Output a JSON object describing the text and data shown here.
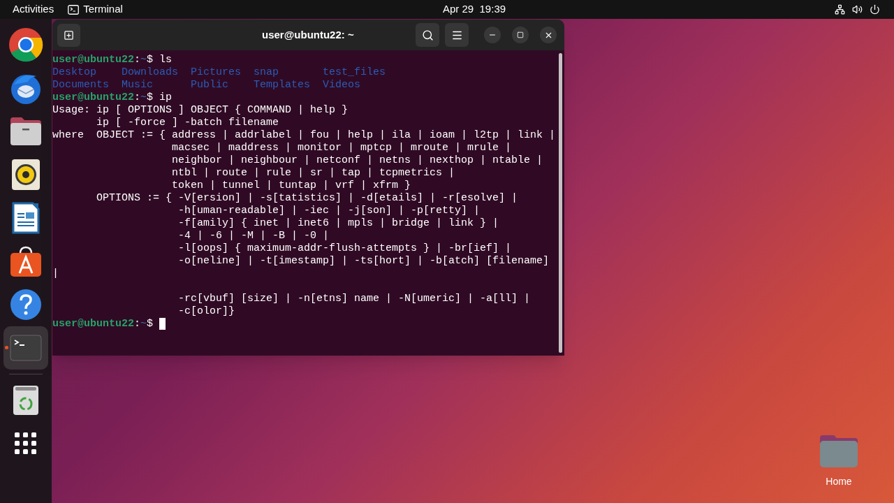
{
  "top_bar": {
    "activities": "Activities",
    "app_name": "Terminal",
    "clock": "Apr 29  19:39"
  },
  "dock": {
    "items": [
      {
        "kind": "chrome",
        "running": false
      },
      {
        "kind": "mail",
        "running": false
      },
      {
        "kind": "files",
        "running": false
      },
      {
        "kind": "speaker",
        "running": false
      },
      {
        "kind": "writer",
        "running": false
      },
      {
        "kind": "store",
        "running": false
      },
      {
        "kind": "help",
        "running": false
      },
      {
        "kind": "terminal",
        "running": true
      },
      {
        "kind": "trash",
        "running": false
      },
      {
        "kind": "apps",
        "running": false
      }
    ]
  },
  "window": {
    "title": "user@ubuntu22: ~"
  },
  "terminal": {
    "lines": [
      {
        "kind": "prompt",
        "user": "user@ubuntu22",
        "separator": ":",
        "path": "~",
        "symbol": "$",
        "command": "ls",
        "cursor": false
      },
      {
        "kind": "listing",
        "entries": [
          "Desktop",
          "Downloads",
          "Pictures",
          "snap",
          "test_files"
        ]
      },
      {
        "kind": "listing",
        "entries": [
          "Documents",
          "Music",
          "Public",
          "Templates",
          "Videos"
        ]
      },
      {
        "kind": "prompt",
        "user": "user@ubuntu22",
        "separator": ":",
        "path": "~",
        "symbol": "$",
        "command": "ip",
        "cursor": false
      },
      {
        "kind": "output",
        "text": "Usage: ip [ OPTIONS ] OBJECT { COMMAND | help }"
      },
      {
        "kind": "output",
        "text": "       ip [ -force ] -batch filename"
      },
      {
        "kind": "output",
        "text": "where  OBJECT := { address | addrlabel | fou | help | ila | ioam | l2tp | link |"
      },
      {
        "kind": "output",
        "text": "                   macsec | maddress | monitor | mptcp | mroute | mrule |"
      },
      {
        "kind": "output",
        "text": "                   neighbor | neighbour | netconf | netns | nexthop | ntable |"
      },
      {
        "kind": "output",
        "text": "                   ntbl | route | rule | sr | tap | tcpmetrics |"
      },
      {
        "kind": "output",
        "text": "                   token | tunnel | tuntap | vrf | xfrm }"
      },
      {
        "kind": "output",
        "text": "       OPTIONS := { -V[ersion] | -s[tatistics] | -d[etails] | -r[esolve] |"
      },
      {
        "kind": "output",
        "text": "                    -h[uman-readable] | -iec | -j[son] | -p[retty] |"
      },
      {
        "kind": "output",
        "text": "                    -f[amily] { inet | inet6 | mpls | bridge | link } |"
      },
      {
        "kind": "output",
        "text": "                    -4 | -6 | -M | -B | -0 |"
      },
      {
        "kind": "output",
        "text": "                    -l[oops] { maximum-addr-flush-attempts } | -br[ief] |"
      },
      {
        "kind": "output",
        "text": "                    -o[neline] | -t[imestamp] | -ts[hort] | -b[atch] [filename]"
      },
      {
        "kind": "output",
        "text": "|"
      },
      {
        "kind": "blank"
      },
      {
        "kind": "output",
        "text": "                    -rc[vbuf] [size] | -n[etns] name | -N[umeric] | -a[ll] |"
      },
      {
        "kind": "output",
        "text": "                    -c[olor]}"
      },
      {
        "kind": "prompt",
        "user": "user@ubuntu22",
        "separator": ":",
        "path": "~",
        "symbol": "$",
        "cursor": true
      }
    ]
  },
  "desktop": {
    "icons": [
      {
        "label": "Home"
      }
    ]
  }
}
